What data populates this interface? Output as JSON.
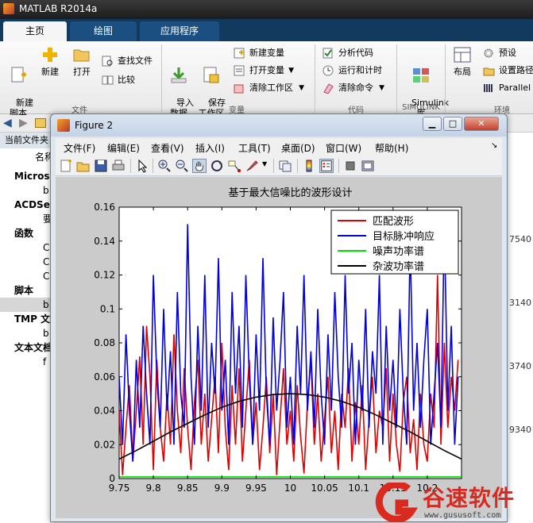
{
  "app": {
    "title": "MATLAB R2014a"
  },
  "tabs": [
    {
      "label": "主页"
    },
    {
      "label": "绘图"
    },
    {
      "label": "应用程序"
    }
  ],
  "ribbon": {
    "new_script": "新建\n脚本",
    "new": "新建",
    "open": "打开",
    "find_files": "查找文件",
    "compare": "比较",
    "group_file": "文件",
    "import_data": "导入\n数据",
    "save_workspace": "保存\n工作区",
    "new_variable": "新建变量",
    "open_variable": "打开变量",
    "clear_workspace": "清除工作区",
    "group_variable": "变量",
    "analyze_code": "分析代码",
    "run_and_time": "运行和计时",
    "clear_commands": "清除命令",
    "group_code": "代码",
    "simulink": "Simulink\n库",
    "group_simulink": "SIMULINK",
    "layout": "布局",
    "preferences": "预设",
    "set_path": "设置路径",
    "parallel": "Parallel",
    "group_env": "环境"
  },
  "left_panel": {
    "current_folder": "当前文件夹",
    "name_header": "名称",
    "sections": [
      {
        "label": "Microsoft"
      },
      {
        "label": "ACDSee"
      },
      {
        "label": "函数"
      },
      {
        "label": "脚本"
      },
      {
        "label": "TMP 文件"
      },
      {
        "label": "文本文档"
      }
    ],
    "items": [
      "b",
      "要",
      "C",
      "C",
      "C",
      "b",
      "b",
      "f"
    ]
  },
  "right_panel": {
    "numbers": [
      "7540",
      "3140",
      "3740",
      "9340"
    ]
  },
  "figure": {
    "title": "Figure 2",
    "menu": [
      "文件(F)",
      "编辑(E)",
      "查看(V)",
      "插入(I)",
      "工具(T)",
      "桌面(D)",
      "窗口(W)",
      "帮助(H)"
    ]
  },
  "chart_data": {
    "type": "line",
    "title": "基于最大信噪比的波形设计",
    "xlabel": "",
    "ylabel": "",
    "xlim": [
      9.75,
      10.25
    ],
    "ylim": [
      0,
      0.16
    ],
    "xticks": [
      "9.75",
      "9.8",
      "9.85",
      "9.9",
      "9.95",
      "10",
      "10.05",
      "10.1",
      "10.15",
      "10.2"
    ],
    "yticks": [
      "0",
      "0.02",
      "0.04",
      "0.06",
      "0.08",
      "0.1",
      "0.12",
      "0.14",
      "0.16"
    ],
    "grid": false,
    "legend_position": "top-right",
    "series": [
      {
        "name": "匹配波形",
        "color": "#e00000",
        "x": [
          9.75,
          9.755,
          9.76,
          9.765,
          9.77,
          9.775,
          9.78,
          9.785,
          9.79,
          9.795,
          9.8,
          9.805,
          9.81,
          9.815,
          9.82,
          9.825,
          9.83,
          9.835,
          9.84,
          9.845,
          9.85,
          9.855,
          9.86,
          9.865,
          9.87,
          9.875,
          9.88,
          9.885,
          9.89,
          9.895,
          9.9,
          9.905,
          9.91,
          9.915,
          9.92,
          9.925,
          9.93,
          9.935,
          9.94,
          9.945,
          9.95,
          9.955,
          9.96,
          9.965,
          9.97,
          9.975,
          9.98,
          9.985,
          9.99,
          9.995,
          10,
          10.005,
          10.01,
          10.015,
          10.02,
          10.025,
          10.03,
          10.035,
          10.04,
          10.045,
          10.05,
          10.055,
          10.06,
          10.065,
          10.07,
          10.075,
          10.08,
          10.085,
          10.09,
          10.095,
          10.1,
          10.105,
          10.11,
          10.115,
          10.12,
          10.125,
          10.13,
          10.135,
          10.14,
          10.145,
          10.15,
          10.155,
          10.16,
          10.165,
          10.17,
          10.175,
          10.18,
          10.185,
          10.19,
          10.195,
          10.2,
          10.205,
          10.21,
          10.215,
          10.22,
          10.225,
          10.23,
          10.235,
          10.24,
          10.245
        ],
        "y": [
          0.04,
          0.002,
          0.03,
          0.055,
          0.01,
          0.04,
          0.072,
          0.02,
          0.09,
          0.06,
          0.005,
          0.07,
          0.03,
          0.01,
          0.05,
          0.02,
          0.085,
          0.04,
          0.015,
          0.065,
          0.03,
          0.005,
          0.045,
          0.07,
          0.02,
          0.05,
          0.01,
          0.035,
          0.06,
          0.015,
          0.08,
          0.03,
          0.005,
          0.055,
          0.02,
          0.065,
          0.01,
          0.04,
          0.07,
          0.02,
          0.045,
          0.005,
          0.03,
          0.06,
          0.015,
          0.05,
          0.002,
          0.035,
          0.065,
          0.02,
          0.04,
          0.01,
          0.055,
          0.025,
          0.003,
          0.045,
          0.07,
          0.02,
          0.05,
          0.01,
          0.035,
          0.06,
          0.015,
          0.04,
          0.005,
          0.05,
          0.03,
          0.065,
          0.01,
          0.045,
          0.02,
          0.055,
          0.005,
          0.035,
          0.06,
          0.015,
          0.04,
          0.03,
          0.065,
          0.01,
          0.05,
          0.02,
          0.004,
          0.045,
          0.06,
          0.015,
          0.035,
          0.005,
          0.05,
          0.02,
          0.01,
          0.05,
          0.03,
          0.12,
          0.02,
          0.08,
          0.03,
          0.06,
          0.04,
          0.07
        ]
      },
      {
        "name": "目标脉冲响应",
        "color": "#0000e0",
        "x": [
          9.75,
          9.755,
          9.76,
          9.765,
          9.77,
          9.775,
          9.78,
          9.785,
          9.79,
          9.795,
          9.8,
          9.805,
          9.81,
          9.815,
          9.82,
          9.825,
          9.83,
          9.835,
          9.84,
          9.845,
          9.85,
          9.855,
          9.86,
          9.865,
          9.87,
          9.875,
          9.88,
          9.885,
          9.89,
          9.895,
          9.9,
          9.905,
          9.91,
          9.915,
          9.92,
          9.925,
          9.93,
          9.935,
          9.94,
          9.945,
          9.95,
          9.955,
          9.96,
          9.965,
          9.97,
          9.975,
          9.98,
          9.985,
          9.99,
          9.995,
          10,
          10.005,
          10.01,
          10.015,
          10.02,
          10.025,
          10.03,
          10.035,
          10.04,
          10.045,
          10.05,
          10.055,
          10.06,
          10.065,
          10.07,
          10.075,
          10.08,
          10.085,
          10.09,
          10.095,
          10.1,
          10.105,
          10.11,
          10.115,
          10.12,
          10.125,
          10.13,
          10.135,
          10.14,
          10.145,
          10.15,
          10.155,
          10.16,
          10.165,
          10.17,
          10.175,
          10.18,
          10.185,
          10.19,
          10.195,
          10.2,
          10.205,
          10.21,
          10.215,
          10.22,
          10.225,
          10.23,
          10.235,
          10.24,
          10.245
        ],
        "y": [
          0.06,
          0.02,
          0.085,
          0.04,
          0.01,
          0.07,
          0.03,
          0.09,
          0.05,
          0.02,
          0.12,
          0.06,
          0.03,
          0.1,
          0.04,
          0.075,
          0.02,
          0.11,
          0.05,
          0.03,
          0.15,
          0.06,
          0.02,
          0.09,
          0.04,
          0.12,
          0.03,
          0.08,
          0.05,
          0.13,
          0.04,
          0.07,
          0.02,
          0.11,
          0.05,
          0.09,
          0.03,
          0.12,
          0.06,
          0.02,
          0.085,
          0.04,
          0.13,
          0.05,
          0.02,
          0.095,
          0.04,
          0.07,
          0.11,
          0.03,
          0.06,
          0.02,
          0.09,
          0.05,
          0.12,
          0.04,
          0.075,
          0.03,
          0.1,
          0.05,
          0.02,
          0.085,
          0.04,
          0.11,
          0.06,
          0.03,
          0.12,
          0.05,
          0.08,
          0.02,
          0.07,
          0.04,
          0.1,
          0.03,
          0.075,
          0.05,
          0.12,
          0.02,
          0.09,
          0.04,
          0.07,
          0.03,
          0.1,
          0.05,
          0.02,
          0.14,
          0.04,
          0.08,
          0.03,
          0.07,
          0.1,
          0.02,
          0.05,
          0.08,
          0.03,
          0.15,
          0.04,
          0.09,
          0.02,
          0.06
        ]
      },
      {
        "name": "噪声功率谱",
        "color": "#00e000",
        "x": [
          9.75,
          10.25
        ],
        "y": [
          0.001,
          0.001
        ]
      },
      {
        "name": "杂波功率谱",
        "color": "#000000",
        "x": [
          9.75,
          9.775,
          9.8,
          9.825,
          9.85,
          9.875,
          9.9,
          9.925,
          9.95,
          9.975,
          10,
          10.025,
          10.05,
          10.075,
          10.1,
          10.125,
          10.15,
          10.175,
          10.2,
          10.225,
          10.25
        ],
        "y": [
          0.0115,
          0.0165,
          0.022,
          0.0275,
          0.0325,
          0.0375,
          0.042,
          0.0455,
          0.048,
          0.0495,
          0.05,
          0.0495,
          0.048,
          0.0455,
          0.042,
          0.0375,
          0.0325,
          0.0275,
          0.022,
          0.0165,
          0.0115
        ]
      }
    ]
  },
  "watermark": {
    "title": "谷速软件",
    "url": "www.gususoft.com"
  },
  "colors": {
    "matlab_tabbar": "#12395e",
    "accent_red": "#d82a1e"
  }
}
